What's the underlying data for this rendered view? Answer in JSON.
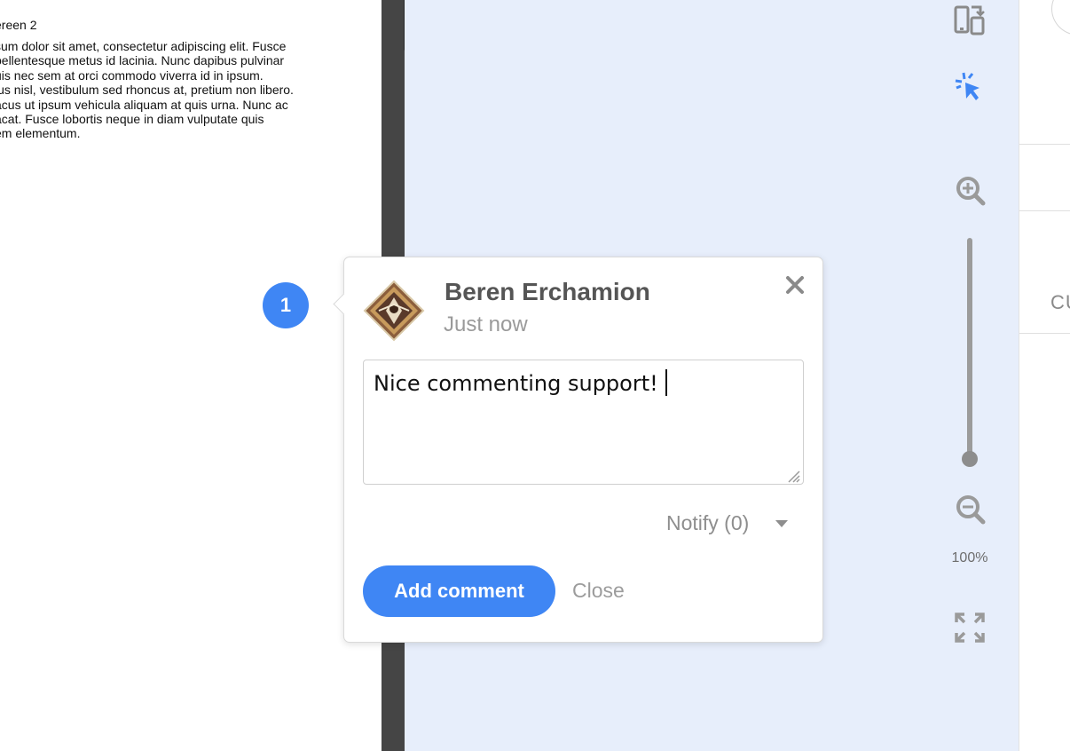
{
  "document": {
    "title": "ereen 2",
    "lines": [
      "sum dolor sit amet, consectetur adipiscing elit. Fusce",
      "pellentesque metus id lacinia. Nunc dapibus pulvinar",
      "uis nec sem at orci commodo viverra id in ipsum.",
      "lus nisl, vestibulum sed rhoncus at, pretium non libero.",
      "acus ut ipsum vehicula aliquam at quis urna. Nunc ac",
      "acat. Fusce lobortis neque in diam vulputate quis",
      "em elementum."
    ]
  },
  "comment_marker": {
    "number": "1"
  },
  "comment": {
    "author": "Beren Erchamion",
    "time": "Just now",
    "text": "Nice commenting support!",
    "notify_label": "Notify (0)",
    "add_label": "Add comment",
    "close_label": "Close"
  },
  "toolbar": {
    "zoom_level": "100%",
    "zoom_percent": 100,
    "icons": [
      "device-switch-icon",
      "click-cursor-icon",
      "zoom-in-icon",
      "zoom-out-icon",
      "fit-screen-icon"
    ]
  },
  "right_panel": {
    "tab_label": "CU"
  },
  "colors": {
    "accent": "#3f86f4",
    "canvas": "#e7eefb",
    "divider": "#454545"
  }
}
